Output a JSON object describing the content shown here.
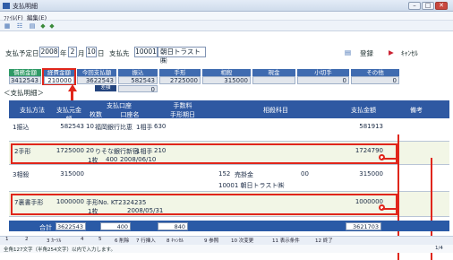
{
  "window": {
    "title": "支払明細",
    "min": "–",
    "max": "□",
    "close": "✕"
  },
  "menu": [
    "ﾌｧｲﾙ(F)",
    "編集(E)"
  ],
  "toolbar": {
    "icons": [
      "header-icon",
      "list-icon",
      "grid-icon",
      "prev-icon",
      "next-icon"
    ],
    "glyphs": [
      "▦",
      "☷",
      "▤",
      "◆",
      "◆"
    ]
  },
  "header": {
    "date_label": "支払予定日",
    "year": "2008",
    "year_unit": "年",
    "month": "2",
    "month_unit": "月",
    "day": "10",
    "day_unit": "日",
    "payee_label": "支払先",
    "payee_code": "10001",
    "payee_name": "朝日トラスト㈱",
    "register_label": "登録",
    "cancel_label": "ｷｬﾝｾﾙ"
  },
  "summary": {
    "headers": [
      "債務金額",
      "経費金額",
      "今回支払額",
      "振込",
      "手形",
      "相殺",
      "現金",
      "小切手",
      "その他"
    ],
    "values": [
      "3412543",
      "210000",
      "3622543",
      "582543",
      "2725000",
      "315000",
      "",
      "0",
      "0"
    ],
    "sub_label": "差額",
    "sub_value": "0"
  },
  "section_label": "＜支払明細＞",
  "table": {
    "headers": {
      "method": "支払方法",
      "amount": "支払元金額",
      "account": "支払口座",
      "fee": "手数料",
      "account_sub": [
        "枚数",
        "口座名"
      ],
      "fee_sub": "手形期日",
      "subject": "相殺科目",
      "paid": "支払金額",
      "note": "備考"
    },
    "rows": [
      {
        "method": "1振込",
        "amount": "582543",
        "no": "10",
        "bank": "福岡銀行比恵",
        "feekind": "1相手",
        "fee": "630",
        "subject": "",
        "paid": "581913"
      },
      {
        "method": "2手形",
        "amount": "1725000",
        "no": "20",
        "bank": "りそな銀行新宿",
        "feekind": "1相手",
        "fee": "210",
        "sub_count": "1枚",
        "sub_amount": "400",
        "sub_date": "2008/06/10",
        "subject": "",
        "paid": "1724790"
      },
      {
        "method": "3相殺",
        "amount": "315000",
        "no": "",
        "bank": "",
        "subject_code": "152",
        "subject": "売掛金",
        "subject_no": "00",
        "subject_partner": "10001 朝日トラスト㈱",
        "paid": "315000"
      },
      {
        "method": "7裏書手形",
        "amount": "1000000",
        "no": "",
        "bank": "手形No. KT2324235",
        "sub_count": "1枚",
        "sub_date": "2008/05/31",
        "subject": "",
        "paid": "1000000"
      }
    ]
  },
  "totals": {
    "label": "合計",
    "amount": "3622543",
    "count": "400",
    "fee": "840",
    "paid": "3621703"
  },
  "fkeys": [
    "1",
    "2",
    "3 ｶｰｿﾙ",
    "4",
    "5",
    "6 削除",
    "7 行挿入",
    "8 ｷｬﾝｾﾙ",
    "9 参照",
    "10 次変更",
    "11 表示条件",
    "12 終了"
  ],
  "status": "全角127文字（半角254文字）以内で入力します。",
  "page": "1/4",
  "colors": {
    "blue": "#2f59a2",
    "green": "#2f9a66",
    "red": "#e0261b"
  }
}
